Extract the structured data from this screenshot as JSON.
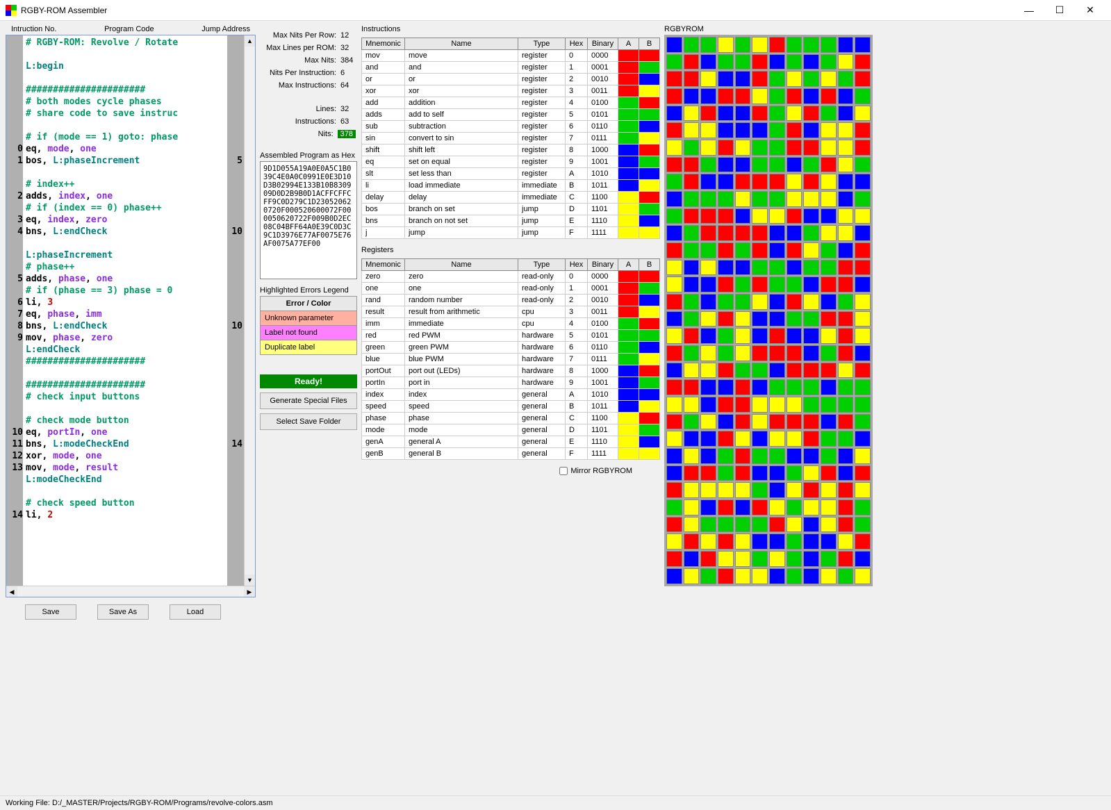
{
  "window": {
    "title": "RGBY-ROM Assembler"
  },
  "labels": {
    "instrNo": "Intruction No.",
    "programCode": "Program Code",
    "jumpAddress": "Jump Address",
    "stats": {
      "maxNitsPerRow": "Max Nits Per Row:",
      "maxLinesPerRom": "Max Lines per ROM:",
      "maxNits": "Max Nits:",
      "nitsPerInstr": "Nits Per Instruction:",
      "maxInstr": "Max Instructions:",
      "lines": "Lines:",
      "instructions": "Instructions:",
      "nits": "Nits:"
    },
    "hexTitle": "Assembled Program as Hex",
    "errTitle": "Highlighted Errors Legend",
    "errHeader": "Error / Color",
    "errUnknown": "Unknown parameter",
    "errLabel": "Label not found",
    "errDup": "Duplicate label",
    "ready": "Ready!",
    "genSpecial": "Generate Special Files",
    "selectFolder": "Select Save Folder",
    "instructionsTitle": "Instructions",
    "registersTitle": "Registers",
    "rgbyrom": "RGBYROM",
    "mirror": "Mirror RGBYROM",
    "save": "Save",
    "saveAs": "Save As",
    "load": "Load",
    "cols": {
      "mnemonic": "Mnemonic",
      "name": "Name",
      "type": "Type",
      "hex": "Hex",
      "binary": "Binary",
      "a": "A",
      "b": "B"
    }
  },
  "stats": {
    "maxNitsPerRow": "12",
    "maxLinesPerRom": "32",
    "maxNits": "384",
    "nitsPerInstr": "6",
    "maxInstr": "64",
    "lines": "32",
    "instructions": "63",
    "nits": "378"
  },
  "hex": "9D1D055A19A0E0A5C1B039C4E0A0C0991E0E3D10D3B02994E133B10B830909D0D2B9B0D1ACFFCFFCFF9C0D279C1D230520620720F000520600072F000050620722F009B0D2EC08C04BFF64A0E39C0D3C9C1D3976E77AF0075E76AF0075A77EF00",
  "statusbar": "Working File: D:/_MASTER/Projects/RGBY-ROM/Programs/revolve-colors.asm",
  "code": [
    {
      "n": "",
      "j": "",
      "ty": "comment",
      "txt": "# RGBY-ROM: Revolve / Rotate"
    },
    {
      "n": "",
      "j": "",
      "ty": "blank",
      "txt": ""
    },
    {
      "n": "",
      "j": "",
      "ty": "label",
      "txt": "L:begin"
    },
    {
      "n": "",
      "j": "",
      "ty": "blank",
      "txt": ""
    },
    {
      "n": "",
      "j": "",
      "ty": "comment",
      "txt": "######################"
    },
    {
      "n": "",
      "j": "",
      "ty": "comment",
      "txt": "# both modes cycle phases"
    },
    {
      "n": "",
      "j": "",
      "ty": "comment",
      "txt": "# share code to save instruc"
    },
    {
      "n": "",
      "j": "",
      "ty": "blank",
      "txt": ""
    },
    {
      "n": "",
      "j": "",
      "ty": "comment",
      "txt": "# if (mode == 1) goto: phase"
    },
    {
      "n": "0",
      "j": "",
      "ty": "inst",
      "mn": "eq",
      "args": [
        "mode",
        "one"
      ]
    },
    {
      "n": "1",
      "j": "5",
      "ty": "inst",
      "mn": "bos",
      "args": [
        "L:phaseIncrement"
      ]
    },
    {
      "n": "",
      "j": "",
      "ty": "blank",
      "txt": ""
    },
    {
      "n": "",
      "j": "",
      "ty": "comment",
      "txt": "# index++"
    },
    {
      "n": "2",
      "j": "",
      "ty": "inst",
      "mn": "adds",
      "args": [
        "index",
        "one"
      ]
    },
    {
      "n": "",
      "j": "",
      "ty": "comment",
      "txt": "# if (index == 0) phase++"
    },
    {
      "n": "3",
      "j": "",
      "ty": "inst",
      "mn": "eq",
      "args": [
        "index",
        "zero"
      ]
    },
    {
      "n": "4",
      "j": "10",
      "ty": "inst",
      "mn": "bns",
      "args": [
        "L:endCheck"
      ]
    },
    {
      "n": "",
      "j": "",
      "ty": "blank",
      "txt": ""
    },
    {
      "n": "",
      "j": "",
      "ty": "label",
      "txt": "L:phaseIncrement"
    },
    {
      "n": "",
      "j": "",
      "ty": "comment",
      "txt": "# phase++"
    },
    {
      "n": "5",
      "j": "",
      "ty": "inst",
      "mn": "adds",
      "args": [
        "phase",
        "one"
      ]
    },
    {
      "n": "",
      "j": "",
      "ty": "comment",
      "txt": "# if (phase == 3) phase = 0"
    },
    {
      "n": "6",
      "j": "",
      "ty": "inst",
      "mn": "li",
      "args": [
        "3"
      ]
    },
    {
      "n": "7",
      "j": "",
      "ty": "inst",
      "mn": "eq",
      "args": [
        "phase",
        "imm"
      ]
    },
    {
      "n": "8",
      "j": "10",
      "ty": "inst",
      "mn": "bns",
      "args": [
        "L:endCheck"
      ]
    },
    {
      "n": "9",
      "j": "",
      "ty": "inst",
      "mn": "mov",
      "args": [
        "phase",
        "zero"
      ]
    },
    {
      "n": "",
      "j": "",
      "ty": "label",
      "txt": "L:endCheck"
    },
    {
      "n": "",
      "j": "",
      "ty": "comment",
      "txt": "######################"
    },
    {
      "n": "",
      "j": "",
      "ty": "blank",
      "txt": ""
    },
    {
      "n": "",
      "j": "",
      "ty": "comment",
      "txt": "######################"
    },
    {
      "n": "",
      "j": "",
      "ty": "comment",
      "txt": "# check input buttons"
    },
    {
      "n": "",
      "j": "",
      "ty": "blank",
      "txt": ""
    },
    {
      "n": "",
      "j": "",
      "ty": "comment",
      "txt": "# check mode button"
    },
    {
      "n": "10",
      "j": "",
      "ty": "inst",
      "mn": "eq",
      "args": [
        "portIn",
        "one"
      ]
    },
    {
      "n": "11",
      "j": "14",
      "ty": "inst",
      "mn": "bns",
      "args": [
        "L:modeCheckEnd"
      ]
    },
    {
      "n": "12",
      "j": "",
      "ty": "inst",
      "mn": "xor",
      "args": [
        "mode",
        "one"
      ]
    },
    {
      "n": "13",
      "j": "",
      "ty": "inst",
      "mn": "mov",
      "args": [
        "mode",
        "result"
      ]
    },
    {
      "n": "",
      "j": "",
      "ty": "label",
      "txt": "L:modeCheckEnd"
    },
    {
      "n": "",
      "j": "",
      "ty": "blank",
      "txt": ""
    },
    {
      "n": "",
      "j": "",
      "ty": "comment",
      "txt": "# check speed button"
    },
    {
      "n": "14",
      "j": "",
      "ty": "inst",
      "mn": "li",
      "args": [
        "2"
      ]
    }
  ],
  "instructions": [
    {
      "m": "mov",
      "n": "move",
      "t": "register",
      "h": "0",
      "b": "0000",
      "a": "red",
      "c": "red"
    },
    {
      "m": "and",
      "n": "and",
      "t": "register",
      "h": "1",
      "b": "0001",
      "a": "red",
      "c": "green"
    },
    {
      "m": "or",
      "n": "or",
      "t": "register",
      "h": "2",
      "b": "0010",
      "a": "red",
      "c": "blue"
    },
    {
      "m": "xor",
      "n": "xor",
      "t": "register",
      "h": "3",
      "b": "0011",
      "a": "red",
      "c": "yellow"
    },
    {
      "m": "add",
      "n": "addition",
      "t": "register",
      "h": "4",
      "b": "0100",
      "a": "green",
      "c": "red"
    },
    {
      "m": "adds",
      "n": "add to self",
      "t": "register",
      "h": "5",
      "b": "0101",
      "a": "green",
      "c": "green"
    },
    {
      "m": "sub",
      "n": "subtraction",
      "t": "register",
      "h": "6",
      "b": "0110",
      "a": "green",
      "c": "blue"
    },
    {
      "m": "sin",
      "n": "convert to sin",
      "t": "register",
      "h": "7",
      "b": "0111",
      "a": "green",
      "c": "yellow"
    },
    {
      "m": "shift",
      "n": "shift left",
      "t": "register",
      "h": "8",
      "b": "1000",
      "a": "blue",
      "c": "red"
    },
    {
      "m": "eq",
      "n": "set on equal",
      "t": "register",
      "h": "9",
      "b": "1001",
      "a": "blue",
      "c": "green"
    },
    {
      "m": "slt",
      "n": "set less than",
      "t": "register",
      "h": "A",
      "b": "1010",
      "a": "blue",
      "c": "blue"
    },
    {
      "m": "li",
      "n": "load immediate",
      "t": "immediate",
      "h": "B",
      "b": "1011",
      "a": "blue",
      "c": "yellow"
    },
    {
      "m": "delay",
      "n": "delay",
      "t": "immediate",
      "h": "C",
      "b": "1100",
      "a": "yellow",
      "c": "red"
    },
    {
      "m": "bos",
      "n": "branch on set",
      "t": "jump",
      "h": "D",
      "b": "1101",
      "a": "yellow",
      "c": "green"
    },
    {
      "m": "bns",
      "n": "branch on not set",
      "t": "jump",
      "h": "E",
      "b": "1110",
      "a": "yellow",
      "c": "blue"
    },
    {
      "m": "j",
      "n": "jump",
      "t": "jump",
      "h": "F",
      "b": "1111",
      "a": "yellow",
      "c": "yellow"
    }
  ],
  "registers": [
    {
      "m": "zero",
      "n": "zero",
      "t": "read-only",
      "h": "0",
      "b": "0000",
      "a": "red",
      "c": "red"
    },
    {
      "m": "one",
      "n": "one",
      "t": "read-only",
      "h": "1",
      "b": "0001",
      "a": "red",
      "c": "green"
    },
    {
      "m": "rand",
      "n": "random number",
      "t": "read-only",
      "h": "2",
      "b": "0010",
      "a": "red",
      "c": "blue"
    },
    {
      "m": "result",
      "n": "result from arithmetic",
      "t": "cpu",
      "h": "3",
      "b": "0011",
      "a": "red",
      "c": "yellow"
    },
    {
      "m": "imm",
      "n": "immediate",
      "t": "cpu",
      "h": "4",
      "b": "0100",
      "a": "green",
      "c": "red"
    },
    {
      "m": "red",
      "n": "red PWM",
      "t": "hardware",
      "h": "5",
      "b": "0101",
      "a": "green",
      "c": "green"
    },
    {
      "m": "green",
      "n": "green PWM",
      "t": "hardware",
      "h": "6",
      "b": "0110",
      "a": "green",
      "c": "blue"
    },
    {
      "m": "blue",
      "n": "blue PWM",
      "t": "hardware",
      "h": "7",
      "b": "0111",
      "a": "green",
      "c": "yellow"
    },
    {
      "m": "portOut",
      "n": "port out (LEDs)",
      "t": "hardware",
      "h": "8",
      "b": "1000",
      "a": "blue",
      "c": "red"
    },
    {
      "m": "portIn",
      "n": "port in",
      "t": "hardware",
      "h": "9",
      "b": "1001",
      "a": "blue",
      "c": "green"
    },
    {
      "m": "index",
      "n": "index",
      "t": "general",
      "h": "A",
      "b": "1010",
      "a": "blue",
      "c": "blue"
    },
    {
      "m": "speed",
      "n": "speed",
      "t": "general",
      "h": "B",
      "b": "1011",
      "a": "blue",
      "c": "yellow"
    },
    {
      "m": "phase",
      "n": "phase",
      "t": "general",
      "h": "C",
      "b": "1100",
      "a": "yellow",
      "c": "red"
    },
    {
      "m": "mode",
      "n": "mode",
      "t": "general",
      "h": "D",
      "b": "1101",
      "a": "yellow",
      "c": "green"
    },
    {
      "m": "genA",
      "n": "general A",
      "t": "general",
      "h": "E",
      "b": "1110",
      "a": "yellow",
      "c": "blue"
    },
    {
      "m": "genB",
      "n": "general B",
      "t": "general",
      "h": "F",
      "b": "1111",
      "a": "yellow",
      "c": "yellow"
    }
  ],
  "rom": [
    "BGGYGYRGGGBBGRBGGRBGBGYRRRYB",
    "BRGYGYGRRBBRRYGRBRBGBYRBBRGY",
    "RGBYRYYBBBGRBYYRYGYRYGGRRYYR",
    "RRGBBGGBGRYGGRBBRRRYRYBBBGGG",
    "YGGYYYBGGRRRBYYRBBYYBGRRRRBB",
    "GYYBRGGRGRBRYGBRYBYBBGGBGGRR",
    "YBBRGRGGBRRBRGBGGYBRYBGYBGYR",
    "YBBGGRRYYRBGYBRBBYRYRGYGYRRR",
    "BGRBBYYRGGBRRRYRRRBBRBGGGBGG",
    "YYBRRYYYGGGGRGYBRYRRRBRGYBBR",
    "YBYYRGGBBYBGRGGBBGBYBRRGRBBG",
    "YRBRRYYYYGBYRYRYGYBRBRYGYYRG",
    "RYGGGGRYBYRGYRYRYBBGBBYRRBRY",
    "YGYGBGRBBYGRYYBGBYGY"
  ]
}
